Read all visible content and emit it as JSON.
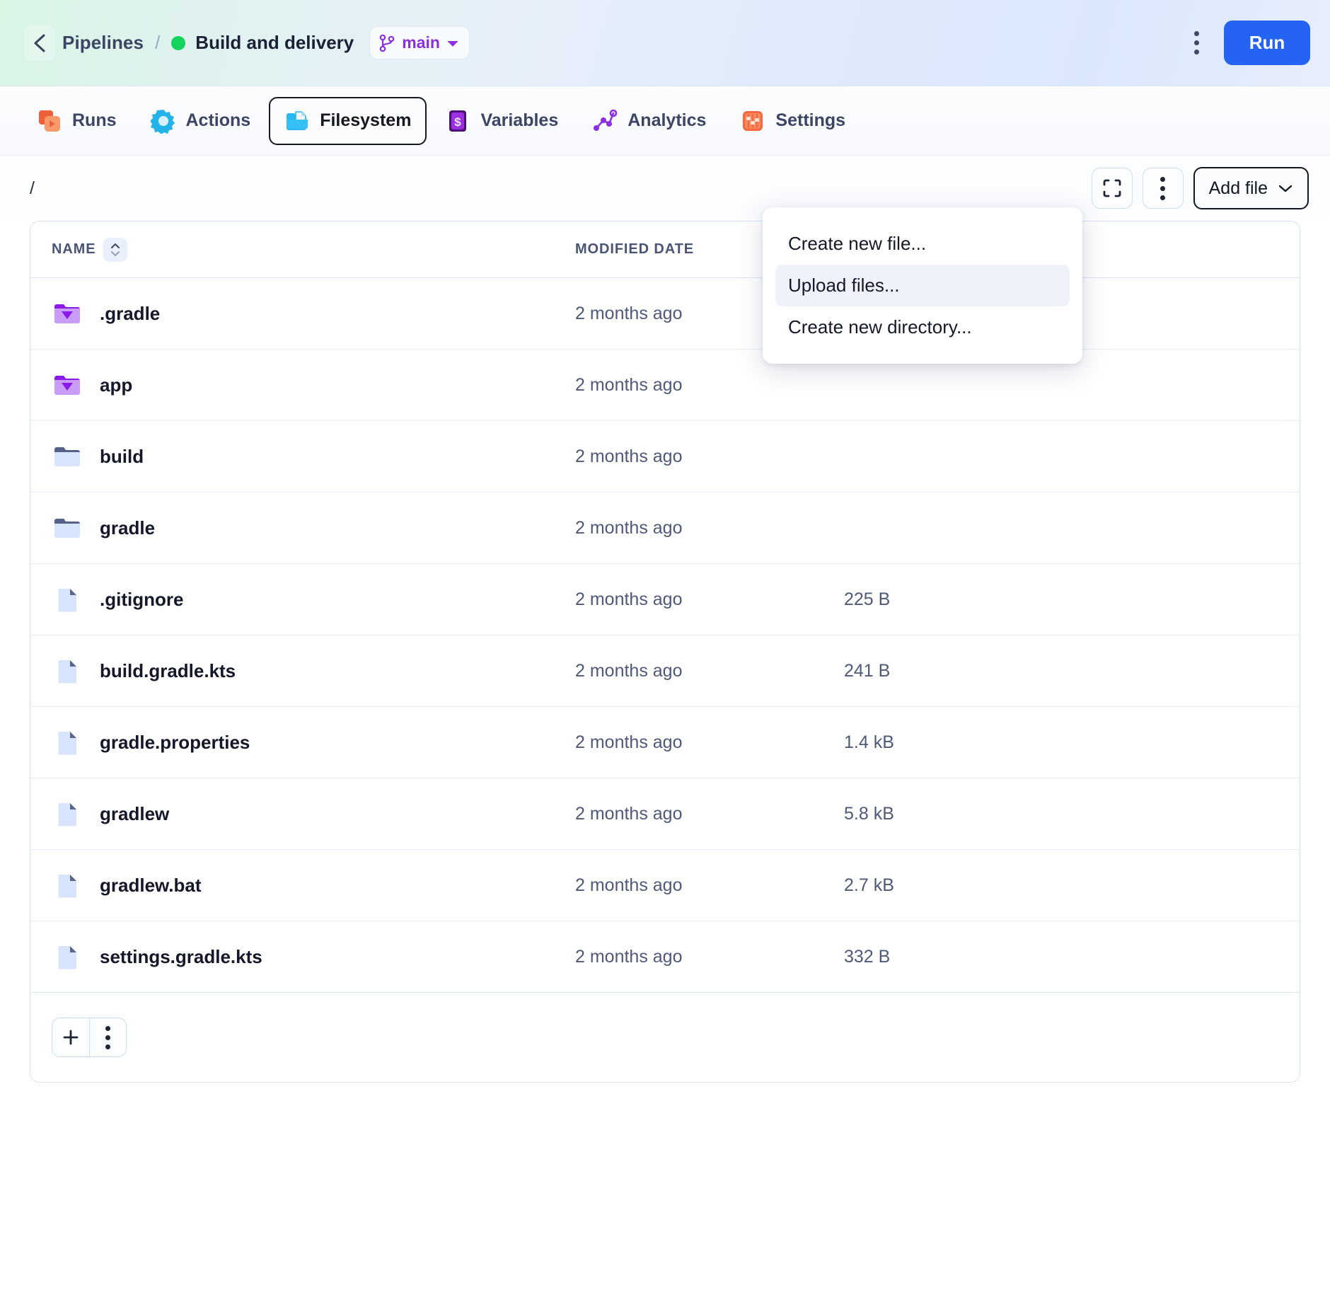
{
  "topbar": {
    "back_icon": "chevron-left-icon",
    "breadcrumb_root": "Pipelines",
    "breadcrumb_sep": "/",
    "breadcrumb_current": "Build and delivery",
    "status_color": "#15d45e",
    "branch": "main",
    "branch_icon": "git-branch-icon",
    "kebab_icon": "kebab-menu-icon",
    "run_label": "Run",
    "run_color": "#2563f2"
  },
  "tabs": [
    {
      "label": "Runs",
      "icon": "runs-icon",
      "active": false
    },
    {
      "label": "Actions",
      "icon": "actions-icon",
      "active": false
    },
    {
      "label": "Filesystem",
      "icon": "filesystem-icon",
      "active": true
    },
    {
      "label": "Variables",
      "icon": "variables-icon",
      "active": false
    },
    {
      "label": "Analytics",
      "icon": "analytics-icon",
      "active": false
    },
    {
      "label": "Settings",
      "icon": "settings-icon",
      "active": false
    }
  ],
  "toolbar": {
    "path": "/",
    "fullscreen_icon": "fullscreen-icon",
    "kebab_icon": "kebab-menu-icon",
    "add_file_label": "Add file",
    "add_file_caret": "chevron-down-icon"
  },
  "dropdown": {
    "items": [
      {
        "label": "Create new file...",
        "highlighted": false
      },
      {
        "label": "Upload files...",
        "highlighted": true
      },
      {
        "label": "Create new directory...",
        "highlighted": false
      }
    ]
  },
  "table": {
    "headers": {
      "name": "NAME",
      "modified": "MODIFIED DATE",
      "size": ""
    },
    "sort_icon": "sort-updown-icon",
    "rows": [
      {
        "name": ".gradle",
        "icon": "folder-gem-icon",
        "modified": "2 months ago",
        "size": ""
      },
      {
        "name": "app",
        "icon": "folder-gem-icon",
        "modified": "2 months ago",
        "size": ""
      },
      {
        "name": "build",
        "icon": "folder-icon",
        "modified": "2 months ago",
        "size": ""
      },
      {
        "name": "gradle",
        "icon": "folder-icon",
        "modified": "2 months ago",
        "size": ""
      },
      {
        "name": ".gitignore",
        "icon": "file-icon",
        "modified": "2 months ago",
        "size": "225 B"
      },
      {
        "name": "build.gradle.kts",
        "icon": "file-icon",
        "modified": "2 months ago",
        "size": "241 B"
      },
      {
        "name": "gradle.properties",
        "icon": "file-icon",
        "modified": "2 months ago",
        "size": "1.4 kB"
      },
      {
        "name": "gradlew",
        "icon": "file-icon",
        "modified": "2 months ago",
        "size": "5.8 kB"
      },
      {
        "name": "gradlew.bat",
        "icon": "file-icon",
        "modified": "2 months ago",
        "size": "2.7 kB"
      },
      {
        "name": "settings.gradle.kts",
        "icon": "file-icon",
        "modified": "2 months ago",
        "size": "332 B"
      }
    ]
  },
  "footer": {
    "add_icon": "plus-icon",
    "kebab_icon": "kebab-menu-icon"
  }
}
